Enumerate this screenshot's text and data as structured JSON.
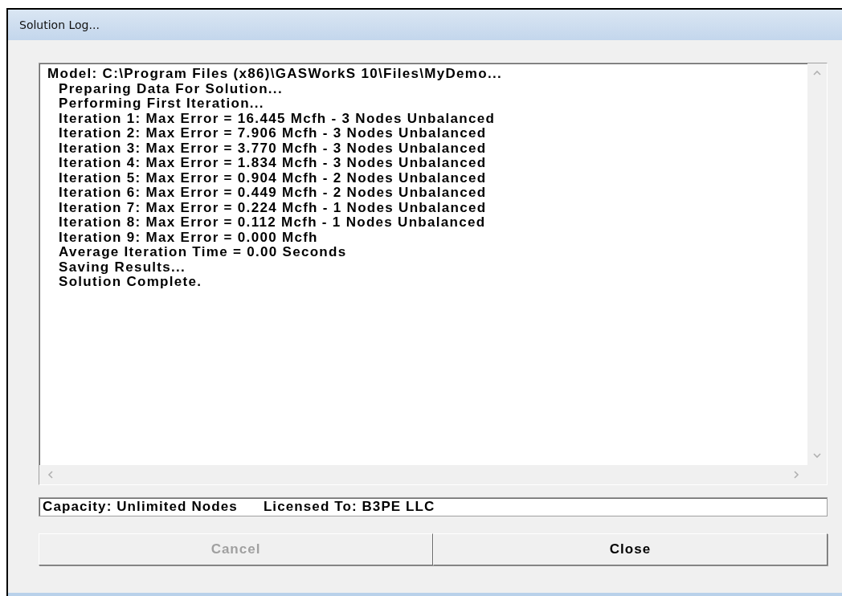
{
  "window": {
    "title": "Solution Log..."
  },
  "log": {
    "header": "Model: C:\\Program Files (x86)\\GASWorkS 10\\Files\\MyDemo...",
    "lines": [
      "Preparing Data For Solution...",
      "Performing First Iteration...",
      "Iteration 1: Max Error = 16.445 Mcfh - 3 Nodes Unbalanced",
      "Iteration 2: Max Error = 7.906 Mcfh - 3 Nodes Unbalanced",
      "Iteration 3: Max Error = 3.770 Mcfh - 3 Nodes Unbalanced",
      "Iteration 4: Max Error = 1.834 Mcfh - 3 Nodes Unbalanced",
      "Iteration 5: Max Error = 0.904 Mcfh - 2 Nodes Unbalanced",
      "Iteration 6: Max Error = 0.449 Mcfh - 2 Nodes Unbalanced",
      "Iteration 7: Max Error = 0.224 Mcfh - 1 Nodes Unbalanced",
      "Iteration 8: Max Error = 0.112 Mcfh - 1 Nodes Unbalanced",
      "Iteration 9: Max Error = 0.000 Mcfh",
      "Average Iteration Time = 0.00 Seconds",
      "Saving Results...",
      "Solution Complete."
    ]
  },
  "status": {
    "capacity": "Capacity: Unlimited Nodes",
    "license": "Licensed To: B3PE LLC"
  },
  "buttons": [
    {
      "label": "Cancel",
      "disabled": true
    },
    {
      "label": "Close",
      "disabled": false
    }
  ]
}
